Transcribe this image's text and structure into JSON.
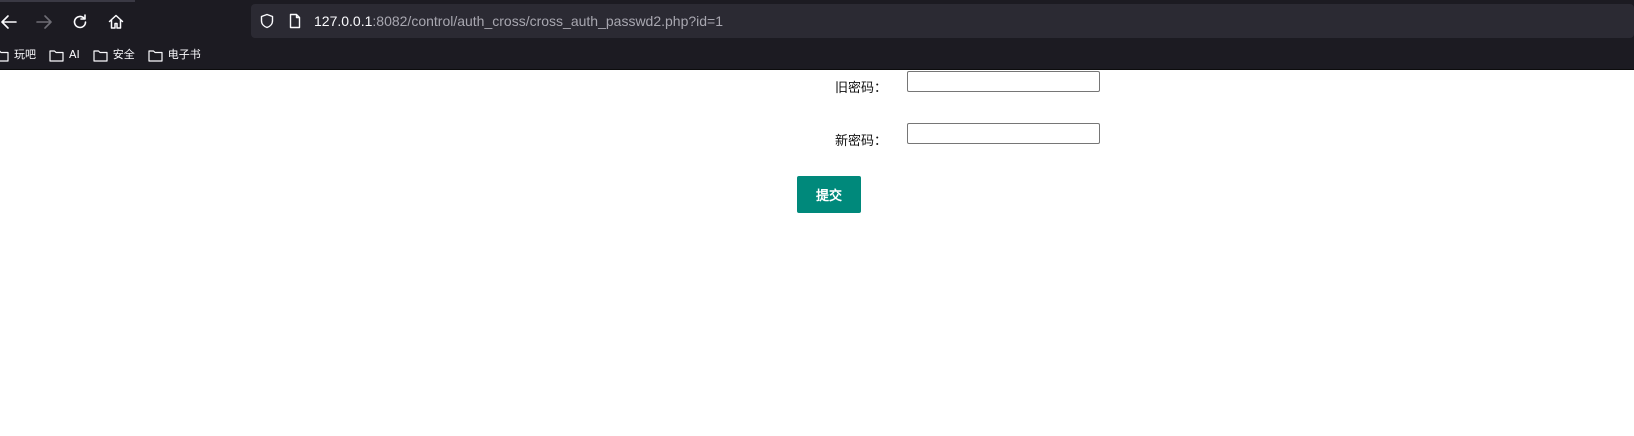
{
  "browser": {
    "url_host": "127.0.0.1",
    "url_rest": ":8082/control/auth_cross/cross_auth_passwd2.php?id=1",
    "bookmarks": [
      {
        "label": "玩吧"
      },
      {
        "label": "AI"
      },
      {
        "label": "安全"
      },
      {
        "label": "电子书"
      }
    ],
    "icons": [
      "back-icon",
      "forward-icon",
      "reload-icon",
      "home-icon",
      "shield-icon",
      "page-icon",
      "folder-icon"
    ]
  },
  "form": {
    "old_password_label": "旧密码：",
    "old_password_value": "",
    "new_password_label": "新密码：",
    "new_password_value": "",
    "submit_label": "提交"
  },
  "colors": {
    "chrome_bg": "#1c1b22",
    "urlbar_bg": "#2b2a33",
    "submit_bg": "#00897b"
  }
}
